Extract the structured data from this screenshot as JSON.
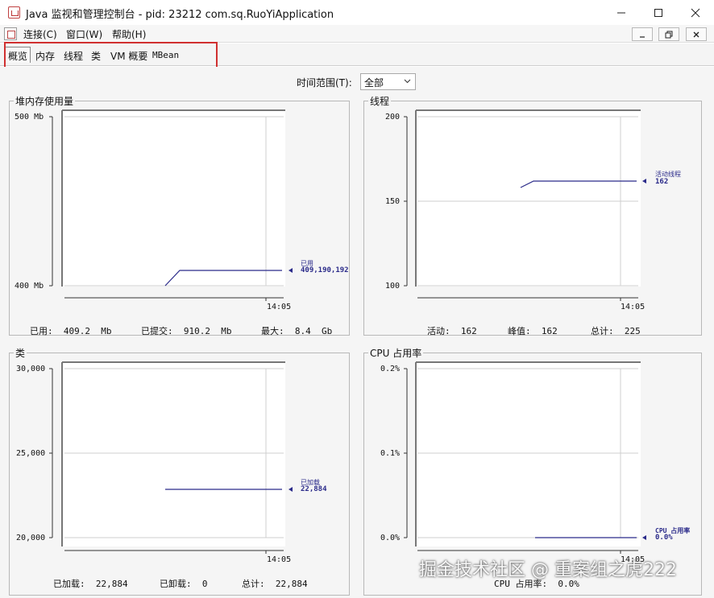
{
  "window": {
    "title": "Java 监视和管理控制台 - pid: 23212 com.sq.RuoYiApplication"
  },
  "menu": {
    "items": [
      "连接(C)",
      "窗口(W)",
      "帮助(H)"
    ]
  },
  "tabs": [
    "概览",
    "内存",
    "线程",
    "类",
    "VM 概要",
    "MBean"
  ],
  "active_tab": "概览",
  "time_range": {
    "label": "时间范围(T):",
    "value": "全部"
  },
  "panels": {
    "heap": {
      "title": "堆内存使用量",
      "y_ticks": [
        "500 Mb",
        "400 Mb"
      ],
      "x_tick": "14:05",
      "legend_name": "已用",
      "legend_value": "409,190,192",
      "stats": [
        {
          "label": "已用:",
          "value": "409.2",
          "unit": "Mb"
        },
        {
          "label": "已提交:",
          "value": "910.2",
          "unit": "Mb"
        },
        {
          "label": "最大:",
          "value": "8.4",
          "unit": "Gb"
        }
      ]
    },
    "threads": {
      "title": "线程",
      "y_ticks": [
        "200",
        "150",
        "100"
      ],
      "x_tick": "14:05",
      "legend_name": "活动线程",
      "legend_value": "162",
      "stats": [
        {
          "label": "活动:",
          "value": "162"
        },
        {
          "label": "峰值:",
          "value": "162"
        },
        {
          "label": "总计:",
          "value": "225"
        }
      ]
    },
    "classes": {
      "title": "类",
      "y_ticks": [
        "30,000",
        "25,000",
        "20,000"
      ],
      "x_tick": "14:05",
      "legend_name": "已加载",
      "legend_value": "22,884",
      "stats": [
        {
          "label": "已加载:",
          "value": "22,884"
        },
        {
          "label": "已卸载:",
          "value": "0"
        },
        {
          "label": "总计:",
          "value": "22,884"
        }
      ]
    },
    "cpu": {
      "title": "CPU 占用率",
      "y_ticks": [
        "0.2%",
        "0.1%",
        "0.0%"
      ],
      "x_tick": "14:05",
      "legend_name": "CPU 占用率",
      "legend_value": "0.0%",
      "stats": [
        {
          "label": "CPU 占用率:",
          "value": "0.0%"
        }
      ]
    }
  },
  "chart_data": [
    {
      "type": "line",
      "title": "堆内存使用量",
      "ylim": [
        400,
        500
      ],
      "y_unit": "Mb",
      "x": [
        "",
        "14:05"
      ],
      "series": [
        {
          "name": "已用",
          "values": [
            400.0,
            409.2,
            409.2
          ]
        }
      ]
    },
    {
      "type": "line",
      "title": "线程",
      "ylim": [
        100,
        200
      ],
      "x": [
        "",
        "14:05"
      ],
      "series": [
        {
          "name": "活动线程",
          "values": [
            158,
            162,
            162
          ]
        }
      ]
    },
    {
      "type": "line",
      "title": "类",
      "ylim": [
        20000,
        30000
      ],
      "x": [
        "",
        "14:05"
      ],
      "series": [
        {
          "name": "已加载",
          "values": [
            22884,
            22884
          ]
        }
      ]
    },
    {
      "type": "line",
      "title": "CPU 占用率",
      "ylim": [
        0.0,
        0.2
      ],
      "y_unit": "%",
      "x": [
        "",
        "14:05"
      ],
      "series": [
        {
          "name": "CPU 占用率",
          "values": [
            0.0,
            0.0
          ]
        }
      ]
    }
  ],
  "colors": {
    "series": "#2b2b8a",
    "grid": "#c8c8c8",
    "highlight": "#d03030"
  },
  "watermark": "掘金技术社区 @ 重案组之虎222"
}
